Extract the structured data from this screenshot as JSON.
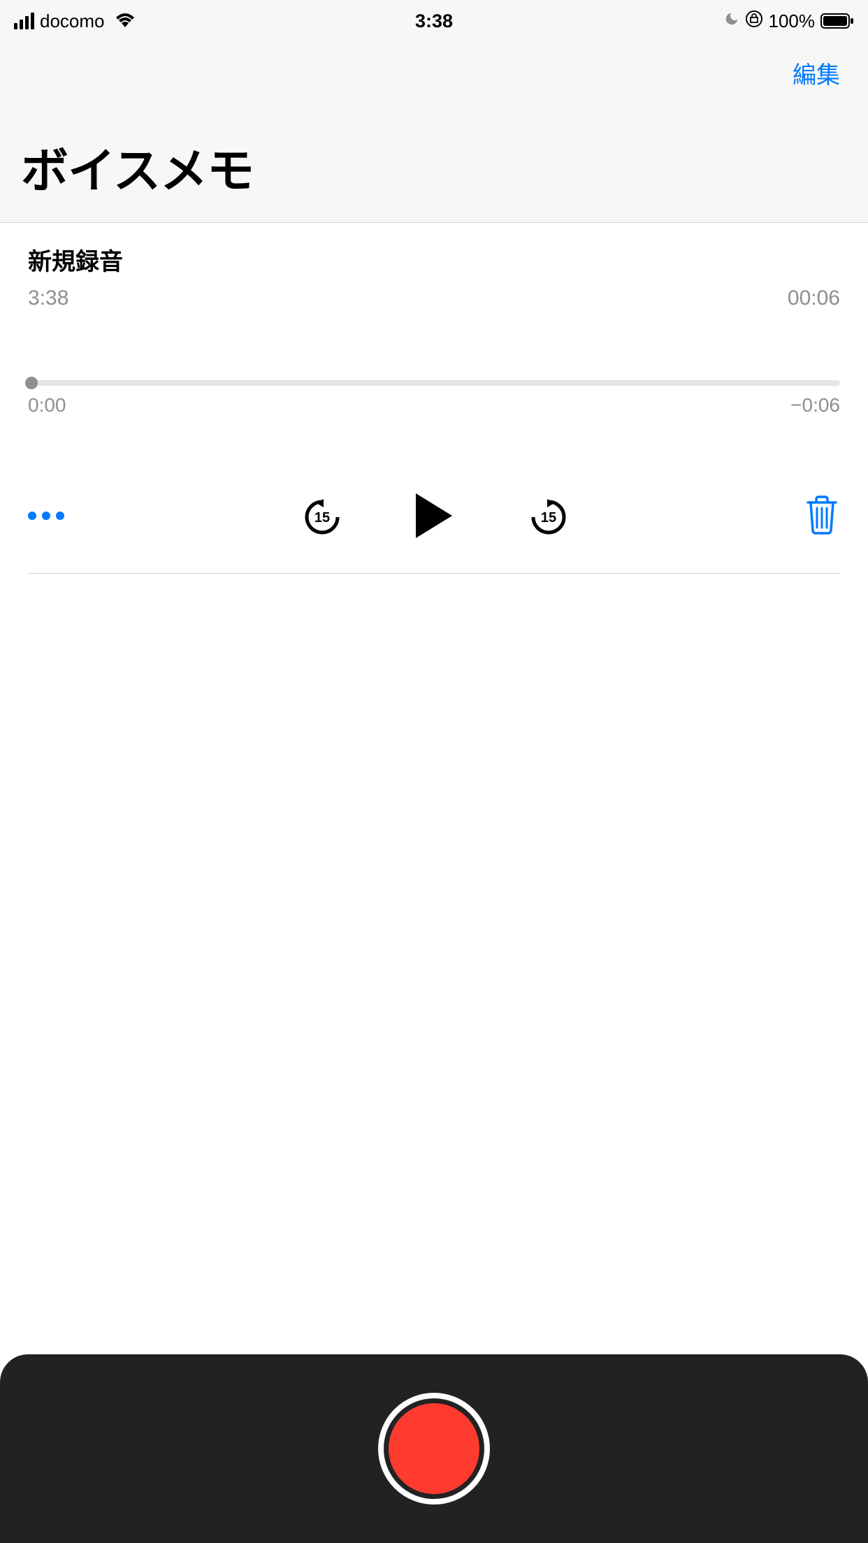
{
  "status": {
    "carrier": "docomo",
    "time": "3:38",
    "battery_pct": "100%"
  },
  "header": {
    "edit": "編集",
    "title": "ボイスメモ"
  },
  "recording": {
    "title": "新規録音",
    "time": "3:38",
    "duration": "00:06",
    "progress_start": "0:00",
    "progress_end": "−0:06",
    "skip_seconds": "15"
  }
}
